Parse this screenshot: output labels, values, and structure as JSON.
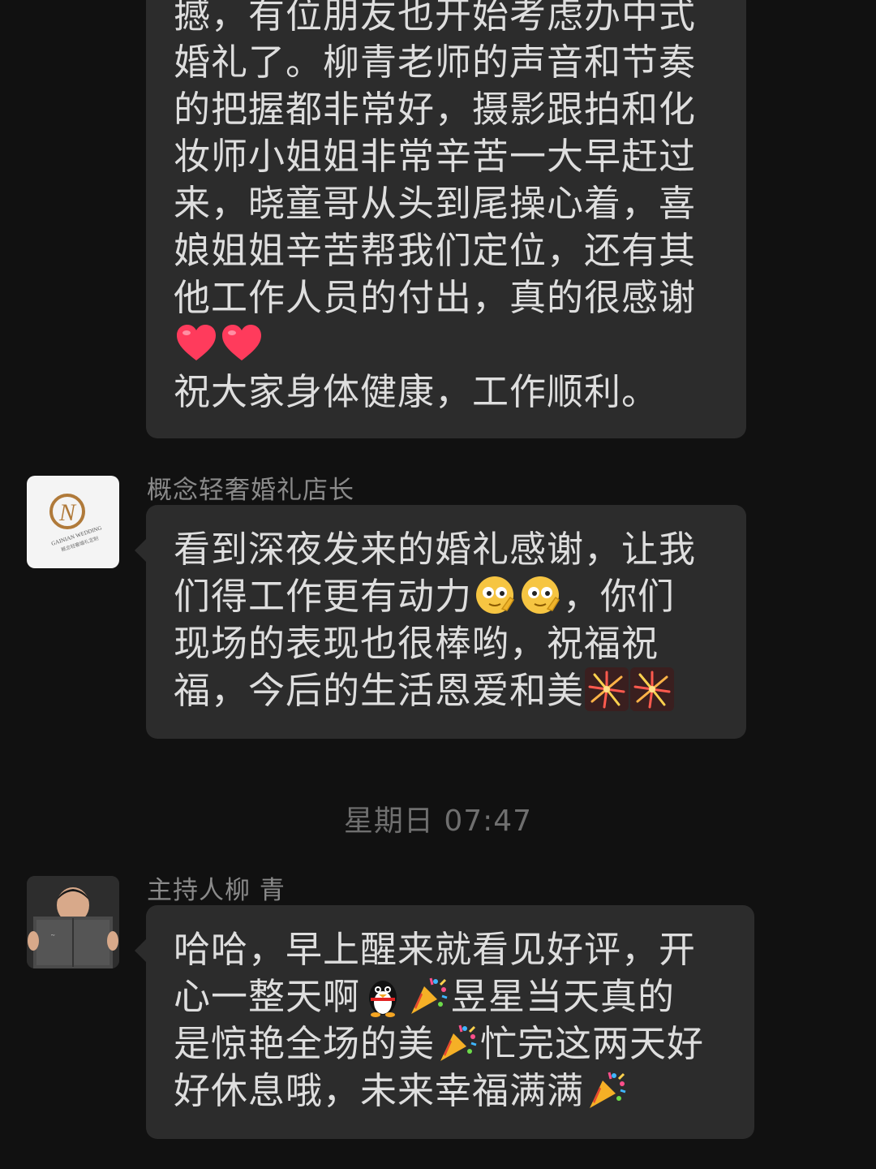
{
  "messages": [
    {
      "lines": [
        "撼，有位朋友也开始考虑办中式",
        "婚礼了。柳青老师的声音和节奏",
        "的把握都非常好，摄影跟拍和化",
        "妆师小姐姐非常辛苦一大早赶过",
        "来，晓童哥从头到尾操心着，喜",
        "娘姐姐辛苦帮我们定位，还有其",
        "他工作人员的付出，真的很感谢",
        "",
        "祝大家身体健康，工作顺利。"
      ],
      "emoji_line_7": [
        "red-heart",
        "red-heart"
      ]
    },
    {
      "sender": "概念轻奢婚礼店长",
      "avatar": {
        "logo_text": "GAINIAN WEDDING",
        "logo_subtext": "概念轻奢婚礼定制"
      },
      "lines": [
        "看到深夜发来的婚礼感谢，让我",
        "们得工作更有动力",
        "，你们",
        "现场的表现也很棒哟，祝福祝",
        "福，今后的生活恩爱和美"
      ],
      "emojis": [
        "thinking-face-emoji",
        "thinking-face-emoji",
        "fireworks-emoji",
        "fireworks-emoji"
      ]
    },
    {
      "timestamp": "星期日 07:47"
    },
    {
      "sender": "主持人柳 青",
      "lines": [
        "哈哈，早上醒来就看见好评，开",
        "心一整天啊",
        "昱星当天真的",
        "是惊艳全场的美",
        "忙完这两天好",
        "好休息哦，未来幸福满满"
      ],
      "emojis": [
        "penguin-emoji",
        "party-popper-emoji",
        "party-popper-emoji",
        "party-popper-emoji"
      ]
    }
  ],
  "colors": {
    "background": "#111111",
    "bubble": "#2c2c2c",
    "text": "#dedede",
    "sender": "#8a8a8a",
    "timestamp": "#6f6f6f"
  }
}
